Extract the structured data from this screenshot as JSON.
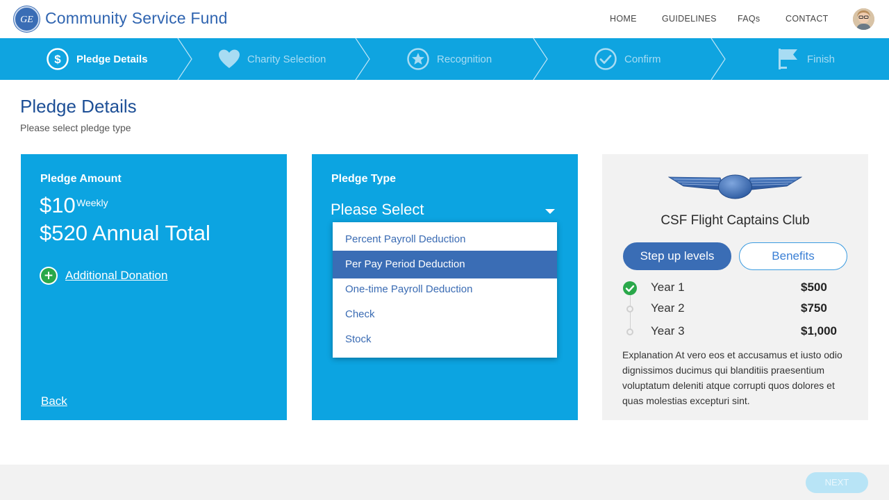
{
  "header": {
    "title": "Community Service Fund",
    "logo_text": "GE",
    "nav": [
      "HOME",
      "GUIDELINES",
      "FAQs",
      "CONTACT"
    ],
    "avatar_icon": "user-avatar"
  },
  "stepper": {
    "steps": [
      {
        "label": "Pledge Details",
        "icon": "dollar-circle-icon",
        "active": true
      },
      {
        "label": "Charity Selection",
        "icon": "heart-icon",
        "active": false
      },
      {
        "label": "Recognition",
        "icon": "star-circle-icon",
        "active": false
      },
      {
        "label": "Confirm",
        "icon": "check-circle-icon",
        "active": false
      },
      {
        "label": "Finish",
        "icon": "flag-icon",
        "active": false
      }
    ]
  },
  "page": {
    "title": "Pledge Details",
    "subtitle": "Please select pledge type"
  },
  "amount_card": {
    "label": "Pledge Amount",
    "amount": "$10",
    "frequency": "Weekly",
    "annual_total": "$520 Annual Total",
    "additional_donation": "Additional Donation",
    "back": "Back"
  },
  "type_card": {
    "label": "Pledge Type",
    "selected_value": "Please Select",
    "options": [
      "Percent Payroll Deduction",
      "Per Pay Period Deduction",
      "One-time Payroll Deduction",
      "Check",
      "Stock"
    ],
    "highlighted_index": 1
  },
  "club_card": {
    "name": "CSF Flight Captains Club",
    "tab_active": "Step up levels",
    "tab_inactive": "Benefits",
    "levels": [
      {
        "name": "Year 1",
        "amount": "$500",
        "achieved": true
      },
      {
        "name": "Year 2",
        "amount": "$750",
        "achieved": false
      },
      {
        "name": "Year 3",
        "amount": "$1,000",
        "achieved": false
      }
    ],
    "explanation": "Explanation At vero eos et accusamus et iusto odio dignissimos ducimus qui blanditiis praesentium voluptatum deleniti atque corrupti quos dolores et quas molestias excepturi sint."
  },
  "footer": {
    "next": "NEXT"
  },
  "colors": {
    "primary_blue": "#0fa4e0",
    "dark_blue": "#3a6db5",
    "title_blue": "#1d4f96",
    "success_green": "#2aa84a",
    "panel_gray": "#f2f2f2"
  }
}
